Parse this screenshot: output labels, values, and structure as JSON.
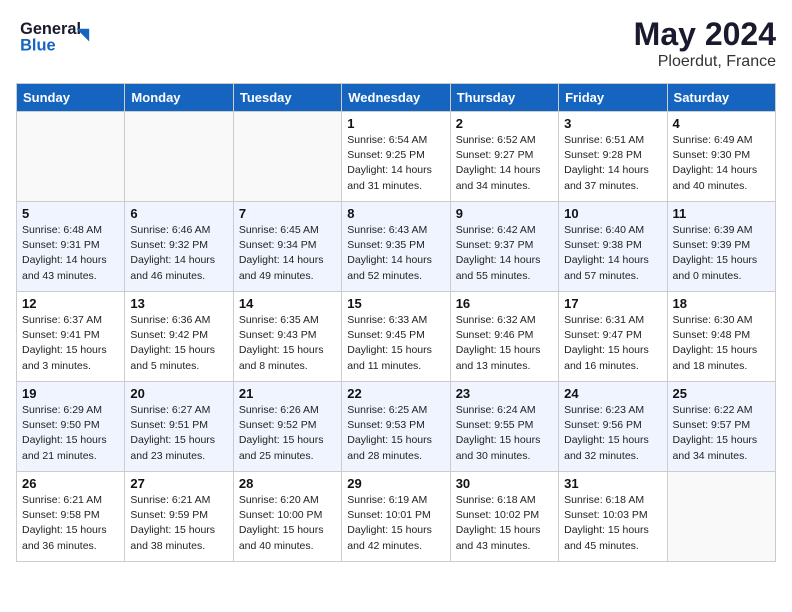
{
  "header": {
    "logo_line1": "General",
    "logo_line2": "Blue",
    "month_title": "May 2024",
    "location": "Ploerdut, France"
  },
  "weekdays": [
    "Sunday",
    "Monday",
    "Tuesday",
    "Wednesday",
    "Thursday",
    "Friday",
    "Saturday"
  ],
  "weeks": [
    [
      {
        "day": "",
        "info": ""
      },
      {
        "day": "",
        "info": ""
      },
      {
        "day": "",
        "info": ""
      },
      {
        "day": "1",
        "info": "Sunrise: 6:54 AM\nSunset: 9:25 PM\nDaylight: 14 hours\nand 31 minutes."
      },
      {
        "day": "2",
        "info": "Sunrise: 6:52 AM\nSunset: 9:27 PM\nDaylight: 14 hours\nand 34 minutes."
      },
      {
        "day": "3",
        "info": "Sunrise: 6:51 AM\nSunset: 9:28 PM\nDaylight: 14 hours\nand 37 minutes."
      },
      {
        "day": "4",
        "info": "Sunrise: 6:49 AM\nSunset: 9:30 PM\nDaylight: 14 hours\nand 40 minutes."
      }
    ],
    [
      {
        "day": "5",
        "info": "Sunrise: 6:48 AM\nSunset: 9:31 PM\nDaylight: 14 hours\nand 43 minutes."
      },
      {
        "day": "6",
        "info": "Sunrise: 6:46 AM\nSunset: 9:32 PM\nDaylight: 14 hours\nand 46 minutes."
      },
      {
        "day": "7",
        "info": "Sunrise: 6:45 AM\nSunset: 9:34 PM\nDaylight: 14 hours\nand 49 minutes."
      },
      {
        "day": "8",
        "info": "Sunrise: 6:43 AM\nSunset: 9:35 PM\nDaylight: 14 hours\nand 52 minutes."
      },
      {
        "day": "9",
        "info": "Sunrise: 6:42 AM\nSunset: 9:37 PM\nDaylight: 14 hours\nand 55 minutes."
      },
      {
        "day": "10",
        "info": "Sunrise: 6:40 AM\nSunset: 9:38 PM\nDaylight: 14 hours\nand 57 minutes."
      },
      {
        "day": "11",
        "info": "Sunrise: 6:39 AM\nSunset: 9:39 PM\nDaylight: 15 hours\nand 0 minutes."
      }
    ],
    [
      {
        "day": "12",
        "info": "Sunrise: 6:37 AM\nSunset: 9:41 PM\nDaylight: 15 hours\nand 3 minutes."
      },
      {
        "day": "13",
        "info": "Sunrise: 6:36 AM\nSunset: 9:42 PM\nDaylight: 15 hours\nand 5 minutes."
      },
      {
        "day": "14",
        "info": "Sunrise: 6:35 AM\nSunset: 9:43 PM\nDaylight: 15 hours\nand 8 minutes."
      },
      {
        "day": "15",
        "info": "Sunrise: 6:33 AM\nSunset: 9:45 PM\nDaylight: 15 hours\nand 11 minutes."
      },
      {
        "day": "16",
        "info": "Sunrise: 6:32 AM\nSunset: 9:46 PM\nDaylight: 15 hours\nand 13 minutes."
      },
      {
        "day": "17",
        "info": "Sunrise: 6:31 AM\nSunset: 9:47 PM\nDaylight: 15 hours\nand 16 minutes."
      },
      {
        "day": "18",
        "info": "Sunrise: 6:30 AM\nSunset: 9:48 PM\nDaylight: 15 hours\nand 18 minutes."
      }
    ],
    [
      {
        "day": "19",
        "info": "Sunrise: 6:29 AM\nSunset: 9:50 PM\nDaylight: 15 hours\nand 21 minutes."
      },
      {
        "day": "20",
        "info": "Sunrise: 6:27 AM\nSunset: 9:51 PM\nDaylight: 15 hours\nand 23 minutes."
      },
      {
        "day": "21",
        "info": "Sunrise: 6:26 AM\nSunset: 9:52 PM\nDaylight: 15 hours\nand 25 minutes."
      },
      {
        "day": "22",
        "info": "Sunrise: 6:25 AM\nSunset: 9:53 PM\nDaylight: 15 hours\nand 28 minutes."
      },
      {
        "day": "23",
        "info": "Sunrise: 6:24 AM\nSunset: 9:55 PM\nDaylight: 15 hours\nand 30 minutes."
      },
      {
        "day": "24",
        "info": "Sunrise: 6:23 AM\nSunset: 9:56 PM\nDaylight: 15 hours\nand 32 minutes."
      },
      {
        "day": "25",
        "info": "Sunrise: 6:22 AM\nSunset: 9:57 PM\nDaylight: 15 hours\nand 34 minutes."
      }
    ],
    [
      {
        "day": "26",
        "info": "Sunrise: 6:21 AM\nSunset: 9:58 PM\nDaylight: 15 hours\nand 36 minutes."
      },
      {
        "day": "27",
        "info": "Sunrise: 6:21 AM\nSunset: 9:59 PM\nDaylight: 15 hours\nand 38 minutes."
      },
      {
        "day": "28",
        "info": "Sunrise: 6:20 AM\nSunset: 10:00 PM\nDaylight: 15 hours\nand 40 minutes."
      },
      {
        "day": "29",
        "info": "Sunrise: 6:19 AM\nSunset: 10:01 PM\nDaylight: 15 hours\nand 42 minutes."
      },
      {
        "day": "30",
        "info": "Sunrise: 6:18 AM\nSunset: 10:02 PM\nDaylight: 15 hours\nand 43 minutes."
      },
      {
        "day": "31",
        "info": "Sunrise: 6:18 AM\nSunset: 10:03 PM\nDaylight: 15 hours\nand 45 minutes."
      },
      {
        "day": "",
        "info": ""
      }
    ]
  ]
}
